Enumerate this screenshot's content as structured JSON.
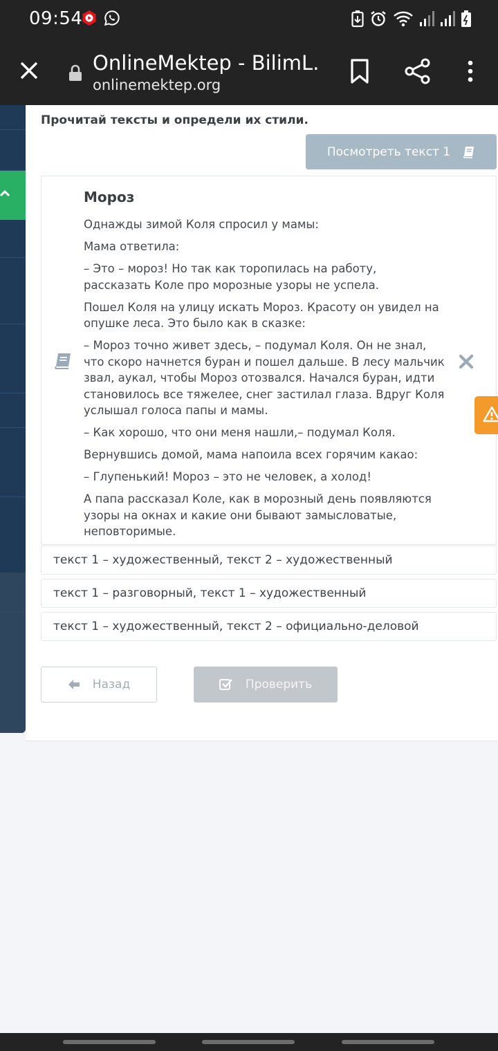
{
  "status_bar": {
    "time": "09:54",
    "left_icons": [
      "youtube-icon",
      "whatsapp-icon"
    ],
    "right_icons": [
      "battery-saver-icon",
      "alarm-icon",
      "wifi-icon",
      "signal-icon",
      "signal-icon",
      "battery-icon"
    ]
  },
  "browser": {
    "title": "OnlineMektep - BilimL...",
    "url": "onlinemektep.org",
    "icons": [
      "close-icon",
      "lock-icon",
      "bookmark-icon",
      "share-icon",
      "more-vert-icon"
    ]
  },
  "task": {
    "instruction": "Прочитай тексты и определи их стили.",
    "view_button_label": "Посмотреть текст 1"
  },
  "text_panel": {
    "title": "Мороз",
    "paragraphs": [
      "Однажды зимой Коля спросил у мамы:",
      "Мама ответила:",
      "– Это – мороз! Но так как торопилась на работу, рассказать Коле про морозные узоры не успела.",
      "Пошел Коля на улицу искать Мороз. Красоту он увидел на опушке леса. Это было как в сказке:",
      "– Мороз точно живет здесь, – подумал Коля. Он не знал, что скоро начнется буран и пошел дальше. В лесу мальчик звал, аукал, чтобы Мороз отозвался. Начался буран, идти становилось все тяжелее, снег застилал глаза. Вдруг Коля услышал голоса папы и мамы.",
      "– Как хорошо, что они меня нашли,– подумал Коля.",
      "Вернувшись домой, мама напоила всех горячим какао:",
      "– Глупенький! Мороз – это не человек, а холод!",
      "А папа рассказал Коле, как в морозный день появляются узоры на окнах и какие они бывают замысловатые, неповторимые."
    ]
  },
  "options": [
    "текст 1 – художественный, текст 2 – художественный",
    "текст 1 – разговорный, текст 1 – художественный",
    "текст 1 – художественный, текст 2 – официально-деловой"
  ],
  "buttons": {
    "back_label": "Назад",
    "check_label": "Проверить"
  },
  "colors": {
    "accent_green": "#2ab065",
    "sidebar_blue": "#1f3a57",
    "view_button": "#a8b9c6",
    "warning_orange": "#f39a2b"
  }
}
